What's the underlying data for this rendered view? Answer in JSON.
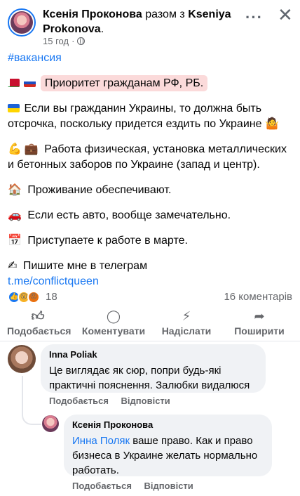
{
  "post": {
    "author_name": "Ксенія Проконова",
    "joiner": "разом з",
    "co_author_name": "Kseniya Prokonova",
    "time": "15 год",
    "hashtag": "#вакансия",
    "line_priority": "Приоритет гражданам РФ, РБ.",
    "line_ukraine": "Если вы гражданин Украины, то должна быть отсрочка, поскольку придется ездить по Украине",
    "line_work": "Работа физическая, установка металлических и бетонных заборов по Украине (запад и центр).",
    "line_housing": "Проживание обеспечивают.",
    "line_car": "Если есть авто, вообще замечательно.",
    "line_start": "Приступаете к работе в марте.",
    "line_contact": "Пишите мне в телеграм",
    "link": "t.me/conflictqueen"
  },
  "stats": {
    "reaction_count": "18",
    "comments_count": "16 коментарів"
  },
  "actions": {
    "like": "Подобається",
    "comment": "Коментувати",
    "send": "Надіслати",
    "share": "Поширити"
  },
  "comments": [
    {
      "name": "Inna Poliak",
      "text": "Це виглядає як сюр, попри будь-які практичні пояснення. Залюбки видалюся",
      "like_label": "Подобається",
      "reply_label": "Відповісти"
    },
    {
      "name": "Ксенія Проконова",
      "mention": "Инна Поляк",
      "text": "ваше право. Как и право бизнеса в Украине желать нормально работать.",
      "like_label": "Подобається",
      "reply_label": "Відповісти"
    }
  ],
  "colors": {
    "accent": "#1877f2",
    "muted": "#65676b",
    "bubble": "#f0f2f5",
    "highlight": "#fbdada"
  }
}
